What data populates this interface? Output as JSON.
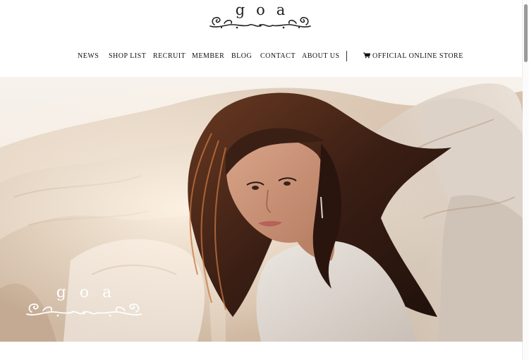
{
  "brand": {
    "logo_text": "goa",
    "hero_logo_text": "goa"
  },
  "nav": {
    "items": [
      {
        "label": "NEWS"
      },
      {
        "label": "SHOP LIST"
      },
      {
        "label": "RECRUIT"
      },
      {
        "label": "MEMBER"
      },
      {
        "label": "BLOG"
      },
      {
        "label": "CONTACT"
      },
      {
        "label": "ABOUT US"
      }
    ],
    "store_label": "OFFICIAL ONLINE STORE",
    "store_icon": "cart-icon"
  },
  "hero": {
    "image": "woman-with-long-windswept-hair-on-rocks"
  },
  "colors": {
    "text": "#111111",
    "hero_logo": "#ffffff"
  }
}
